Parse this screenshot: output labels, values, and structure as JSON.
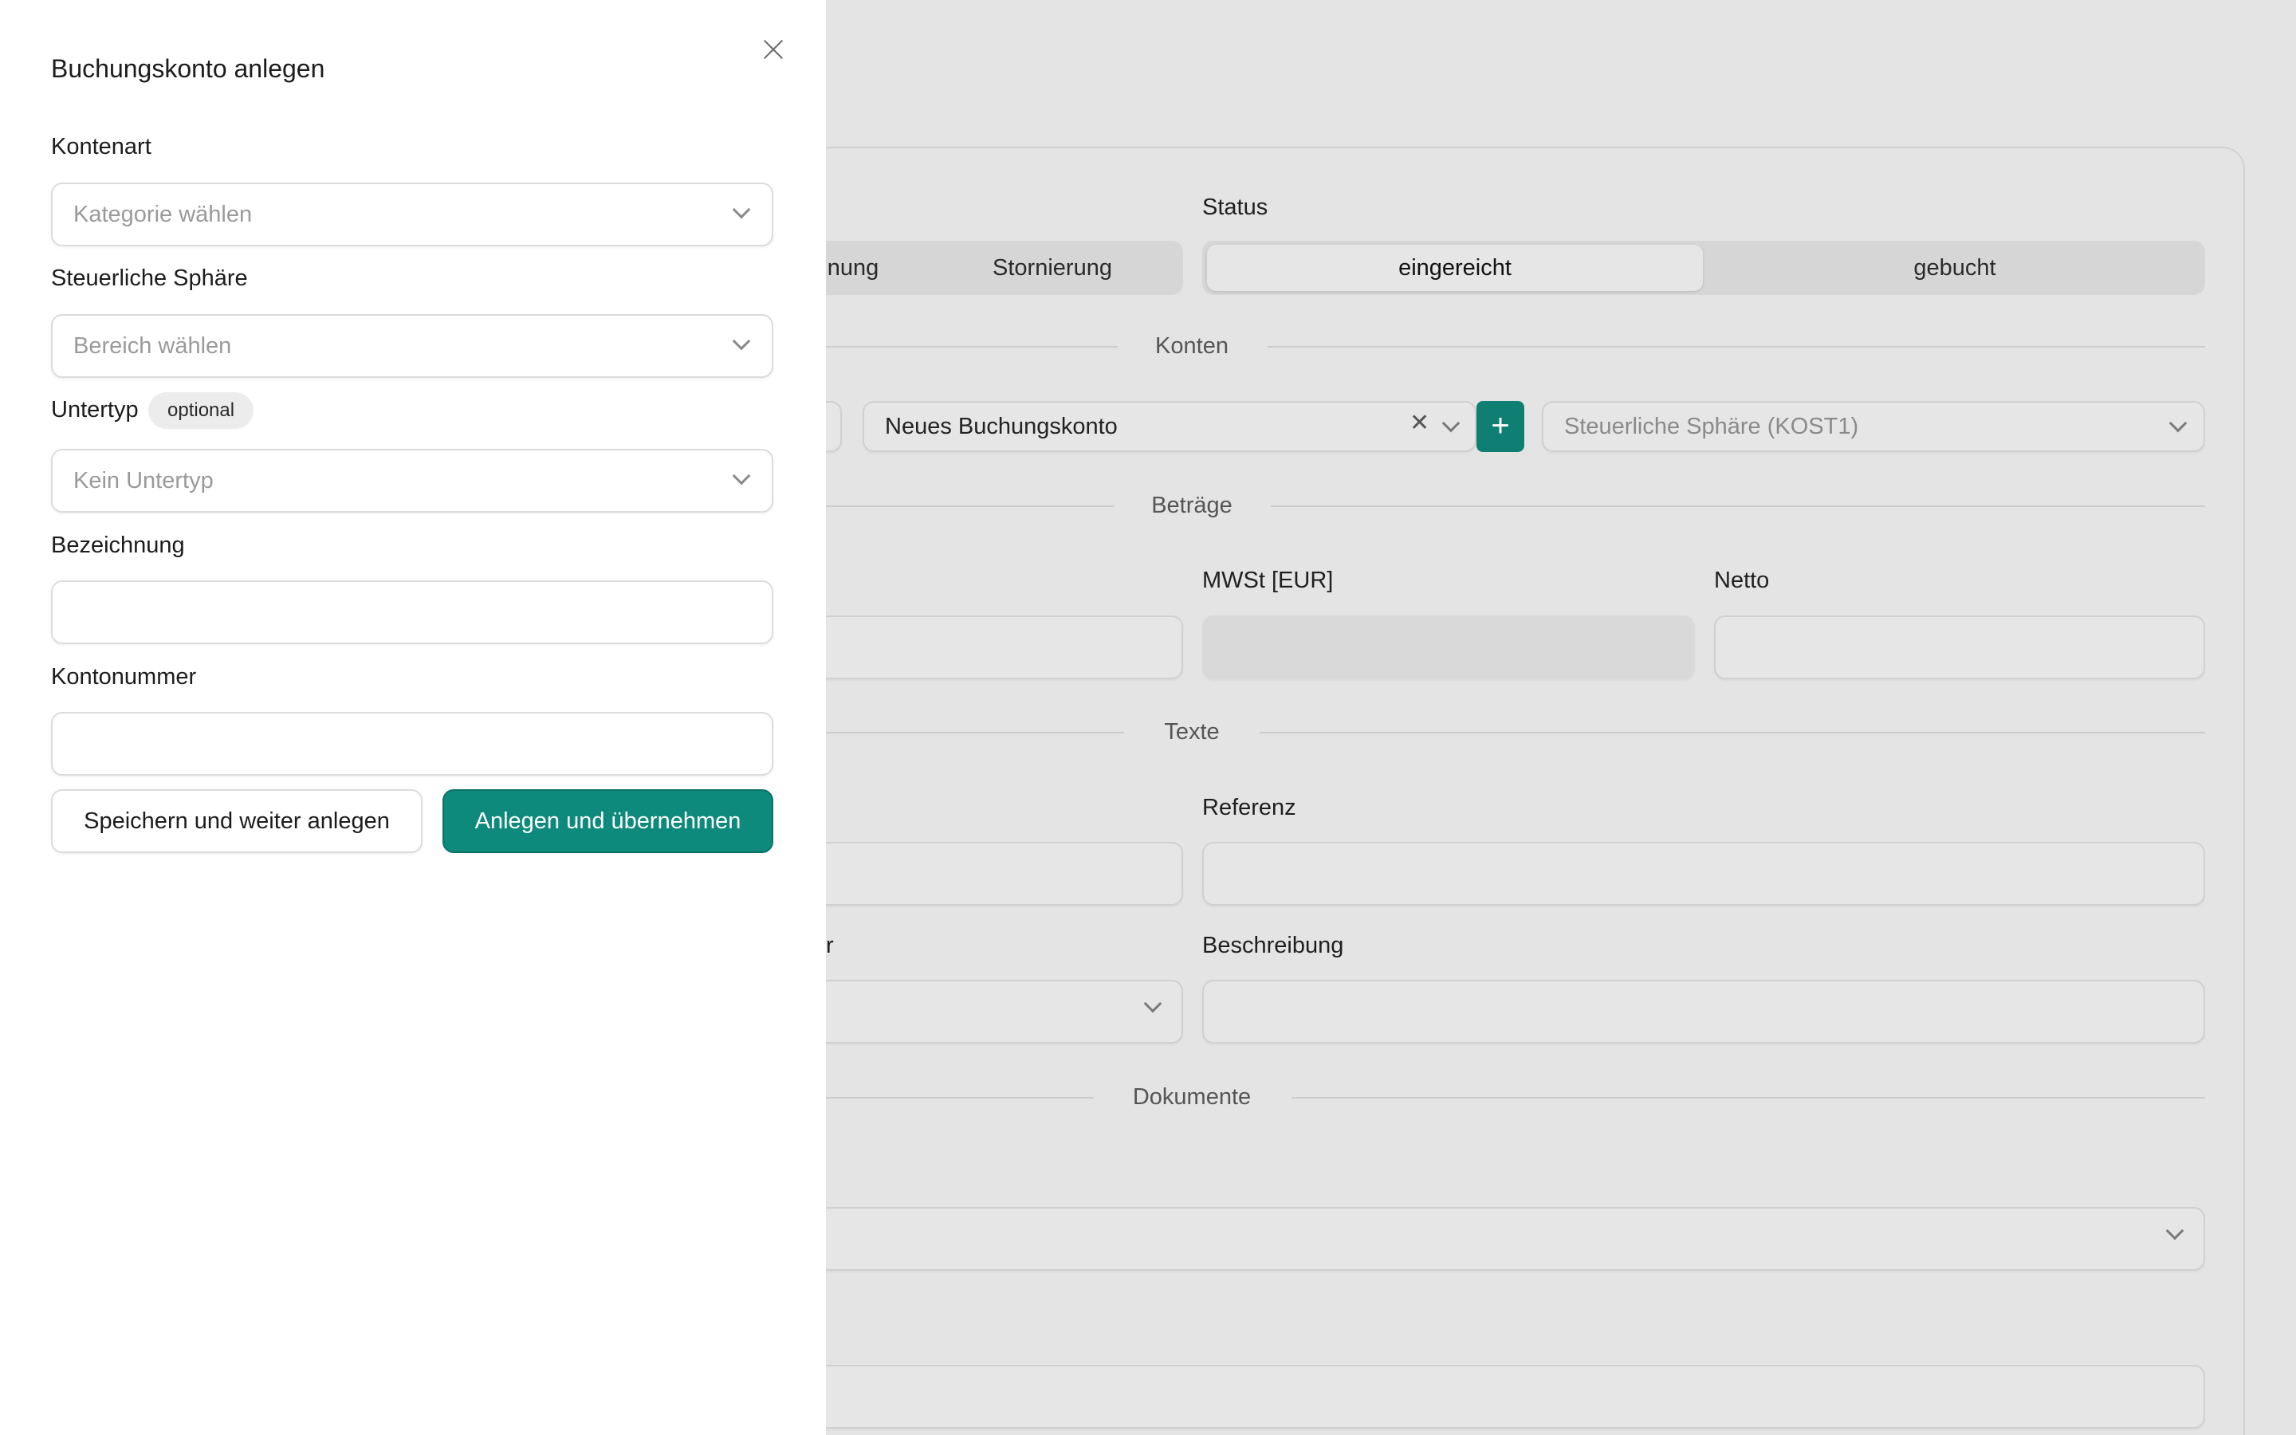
{
  "drawer": {
    "title": "Buchungskonto anlegen",
    "fields": {
      "kontenart": {
        "label": "Kontenart",
        "placeholder": "Kategorie wählen"
      },
      "sphaere": {
        "label": "Steuerliche Sphäre",
        "placeholder": "Bereich wählen"
      },
      "untertyp": {
        "label": "Untertyp",
        "badge": "optional",
        "placeholder": "Kein Untertyp"
      },
      "bezeichnung": {
        "label": "Bezeichnung",
        "value": ""
      },
      "kontonummer": {
        "label": "Kontonummer",
        "value": ""
      }
    },
    "buttons": {
      "secondary": "Speichern und weiter anlegen",
      "primary": "Anlegen und übernehmen"
    }
  },
  "background": {
    "status_label": "Status",
    "type_segment": {
      "partial": "nung",
      "storno": "Stornierung"
    },
    "status_segment": {
      "submitted": "eingereicht",
      "booked": "gebucht",
      "active": "eingereicht"
    },
    "sections": {
      "konten": "Konten",
      "betraege": "Beträge",
      "texte": "Texte",
      "dokumente": "Dokumente"
    },
    "konto_select": "Neues Buchungskonto",
    "sphaere_select": "Steuerliche Sphäre (KOST1)",
    "labels": {
      "mwst": "MWSt [EUR]",
      "netto": "Netto",
      "referenz": "Referenz",
      "partial_left": "r",
      "beschreibung": "Beschreibung"
    }
  },
  "colors": {
    "accent": "#0e8a7c",
    "overlay_bg": "#e4e4e4",
    "drawer_bg": "#ffffff"
  }
}
